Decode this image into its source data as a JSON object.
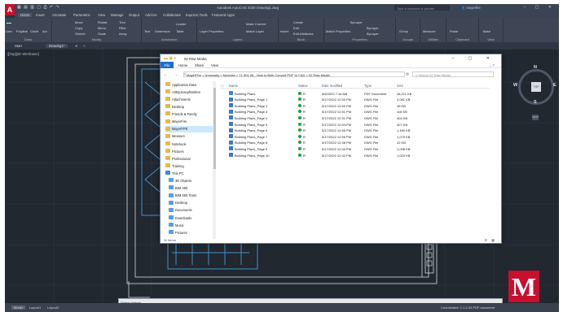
{
  "acad": {
    "window_title": "Autodesk AutoCAD 2020   Drawing1.dwg",
    "search_placeholder": "Type a keyword or phrase",
    "username": "mayerfire",
    "menu_tabs": [
      "Home",
      "Insert",
      "Annotate",
      "Parametric",
      "View",
      "Manage",
      "Output",
      "Add-ins",
      "Collaborate",
      "Express Tools",
      "Featured Apps"
    ],
    "ribbon_panels": [
      "Draw",
      "Modify",
      "Annotation",
      "Layers",
      "Block",
      "Properties",
      "Groups",
      "Utilities",
      "Clipboard",
      "View"
    ],
    "ribbon_buttons": {
      "line": "Line",
      "polyline": "Polyline",
      "circle": "Circle",
      "arc": "Arc",
      "move": "Move",
      "rotate": "Rotate",
      "trim": "Trim",
      "copy": "Copy",
      "mirror": "Mirror",
      "fillet": "Fillet",
      "stretch": "Stretch",
      "scale": "Scale",
      "array": "Array",
      "text": "Text",
      "dimension": "Dimension",
      "leader": "Leader",
      "table": "Table",
      "layer_properties": "Layer Properties",
      "make_current": "Make Current",
      "match_layer": "Match Layer",
      "insert": "Insert",
      "create": "Create",
      "edit": "Edit",
      "edit_attributes": "Edit Attributes",
      "match_properties": "Match Properties",
      "bylayer": "ByLayer",
      "group": "Group",
      "measure": "Measure",
      "paste": "Paste",
      "base": "Base"
    },
    "file_tabs": [
      "Start",
      "Drawing1*"
    ],
    "viewport_label": "-][Top][2D Wireframe]",
    "viewcube": {
      "top": "TOP",
      "north": "N",
      "south": "S",
      "east": "E",
      "west": "W",
      "wcs": "WCS"
    },
    "command_prompt": "Select objects:",
    "status_tabs": [
      "Model",
      "Layout1",
      "Layout2"
    ],
    "status_right": "Coordinates: 1.1,2.34 PDF document",
    "accent_color": "#c3122d"
  },
  "explorer": {
    "title": "02 Raw Media",
    "ribbon_tabs": [
      "File",
      "Home",
      "Share",
      "View"
    ],
    "address_path": "MayerFire > University > Modules > TL.501.06 - How to Bulk Convert PDF to CAD > 02 Raw Media",
    "search_placeholder": "Search 02 Raw Media",
    "nav_items": [
      {
        "label": "Application Data",
        "icon": "folder-icon",
        "selected": false
      },
      {
        "label": "ArtByJosephDalton",
        "icon": "folder-icon",
        "selected": false
      },
      {
        "label": "Attachments",
        "icon": "folder-icon",
        "selected": false
      },
      {
        "label": "Desktop",
        "icon": "folder-icon",
        "selected": false
      },
      {
        "label": "Friends & Family",
        "icon": "folder-icon",
        "selected": false
      },
      {
        "label": "MayerFire",
        "icon": "folder-icon",
        "selected": false
      },
      {
        "label": "MayerFPE",
        "icon": "folder-icon",
        "selected": true
      },
      {
        "label": "Measure",
        "icon": "folder-icon",
        "selected": false
      },
      {
        "label": "Notebook",
        "icon": "folder-icon",
        "selected": false
      },
      {
        "label": "Pictures",
        "icon": "folder-icon",
        "selected": false
      },
      {
        "label": "Professional",
        "icon": "folder-icon",
        "selected": false
      },
      {
        "label": "Training",
        "icon": "folder-icon",
        "selected": false
      },
      {
        "label": "This PC",
        "icon": "pc-icon",
        "selected": false
      },
      {
        "label": "3D Objects",
        "icon": "cube-icon",
        "selected": false
      },
      {
        "label": "BIM 360",
        "icon": "bim-icon",
        "selected": false
      },
      {
        "label": "BIM 360 Team",
        "icon": "bim-icon",
        "selected": false
      },
      {
        "label": "Desktop",
        "icon": "desktop-icon",
        "selected": false
      },
      {
        "label": "Documents",
        "icon": "documents-icon",
        "selected": false
      },
      {
        "label": "Downloads",
        "icon": "downloads-icon",
        "selected": false
      },
      {
        "label": "Music",
        "icon": "music-icon",
        "selected": false
      },
      {
        "label": "Pictures",
        "icon": "pictures-icon",
        "selected": false
      }
    ],
    "columns": [
      "Name",
      "Status",
      "Date modified",
      "Type",
      "Size"
    ],
    "files": [
      {
        "name": "Building Plans",
        "status": "R",
        "date": "5/5/2022 7:16 AM",
        "type": "PDF Document",
        "size": "46,211 KB",
        "icon": "pdf-icon"
      },
      {
        "name": "Building Plans_Page 1",
        "status": "R",
        "date": "5/17/2022 12:50 PM",
        "type": "DWG File",
        "size": "2,081 KB",
        "icon": "dwg-icon"
      },
      {
        "name": "Building Plans_Page 2",
        "status": "R",
        "date": "5/17/2022 12:50 PM",
        "type": "DWG File",
        "size": "46 KB",
        "icon": "dwg-icon"
      },
      {
        "name": "Building Plans_Page 3",
        "status": "R",
        "date": "5/17/2022 12:51 PM",
        "type": "DWG File",
        "size": "116 KB",
        "icon": "dwg-icon"
      },
      {
        "name": "Building Plans_Page 4",
        "status": "R",
        "date": "5/17/2022 12:51 PM",
        "type": "DWG File",
        "size": "404 KB",
        "icon": "dwg-icon"
      },
      {
        "name": "Building Plans_Page 5",
        "status": "R",
        "date": "5/17/2022 12:53 PM",
        "type": "DWG File",
        "size": "307 KB",
        "icon": "dwg-icon"
      },
      {
        "name": "Building Plans_Page 6",
        "status": "R",
        "date": "5/17/2022 12:55 PM",
        "type": "DWG File",
        "size": "1,160 KB",
        "icon": "dwg-icon"
      },
      {
        "name": "Building Plans_Page 7",
        "status": "R",
        "date": "5/17/2022 12:56 PM",
        "type": "DWG File",
        "size": "1,079 KB",
        "icon": "dwg-icon"
      },
      {
        "name": "Building Plans_Page 8",
        "status": "R",
        "date": "5/17/2022 12:38 PM",
        "type": "DWG File",
        "size": "22 KB",
        "icon": "dwg-icon"
      },
      {
        "name": "Building Plans_Page 9",
        "status": "R",
        "date": "5/17/2022 12:40 PM",
        "type": "DWG File",
        "size": "1,098 KB",
        "icon": "dwg-icon"
      },
      {
        "name": "Building Plans_Page 10",
        "status": "R",
        "date": "5/17/2022 12:42 PM",
        "type": "DWG File",
        "size": "1,020 KB",
        "icon": "dwg-icon"
      }
    ],
    "item_count": "11 items"
  },
  "logo": {
    "letter": "M",
    "color": "#c8102e"
  }
}
